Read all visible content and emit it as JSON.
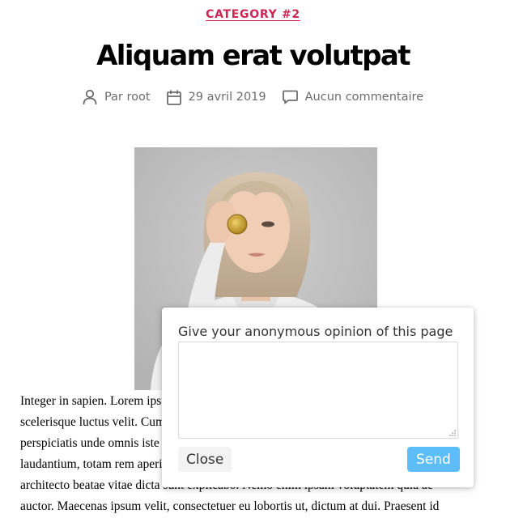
{
  "post": {
    "category": "CATEGORY #2",
    "title": "Aliquam erat volutpat",
    "meta": {
      "author": "Par root",
      "date": "29 avril 2019",
      "comments": "Aucun commentaire"
    },
    "body_lines": [
      "Integer in sapien. Lorem ipsum dolor sit amet, consectetuer adipiscing elit. Morbi",
      "scelerisque luctus velit. Cum sociis natoque penatibus et magnis dis parturient, ut",
      "perspiciatis unde omnis iste natus error sit voluptatem accusantium doloremque",
      "laudantium, totam rem aperiam, eaque ipsa quae ab illo inventore veritatis et quasi",
      "architecto beatae vitae dicta sunt explicabo. Nemo enim ipsam voluptatem quia ac",
      "auctor. Maecenas ipsum velit, consectetuer eu lobortis ut, dictum at dui. Praesent id"
    ]
  },
  "feedback": {
    "prompt": "Give your anonymous opinion of this page",
    "textarea_value": "",
    "close_label": "Close",
    "send_label": "Send"
  },
  "colors": {
    "category": "#cd2653",
    "meta_text": "#6d6d6d",
    "send_button": "#5cbdf8"
  },
  "icons": {
    "author": "person-icon",
    "date": "calendar-icon",
    "comments": "speech-bubble-icon"
  }
}
